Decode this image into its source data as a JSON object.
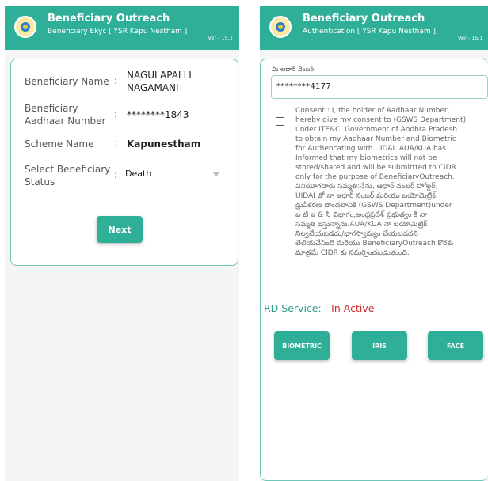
{
  "app": {
    "title": "Beneficiary Outreach",
    "version": "Ver - 15.1",
    "brand_color": "#2fae98"
  },
  "left_screen": {
    "subtitle": "Beneficiary Ekyc [ YSR Kapu Nestham ]",
    "fields": {
      "name_label": "Beneficiary Name",
      "name_value_1": "NAGULAPALLI",
      "name_value_2": "NAGAMANI",
      "aadhaar_label_1": "Beneficiary",
      "aadhaar_label_2": "Aadhaar Number",
      "aadhaar_value": "********1843",
      "scheme_label": "Scheme Name",
      "scheme_value": "Kapunestham",
      "status_label_1": "Select Beneficiary",
      "status_label_2": "Status",
      "status_value": "Death",
      "colon": ":"
    },
    "next_label": "Next"
  },
  "right_screen": {
    "subtitle": "Authentication [ YSR Kapu Nestham ]",
    "aadhaar_label": "మీ ఆధార్ నెంబర్",
    "aadhaar_value": "********4177",
    "consent_lines": [
      "Consent : I, the holder of Aadhaar Number,",
      "hereby give my consent to (GSWS Department)",
      "under ITE&C, Government of Andhra Pradesh",
      "to obtain my Aadhaar Number and Biometric",
      "for Authencating with UIDAI. AUA/KUA has",
      "Informed that my biometrics will not be",
      "stored/shared and will be submittted to CIDR",
      "only for the purpose of BeneficiaryOutreach.",
      "వినియోగదారు సమ్మతి:నేను, ఆధార్ నంబర్ హోల్డర్,",
      "UIDAI తో నా ఆధార్ నంబర్ మరియు బయోమెట్రిక్",
      "ధ్రువీకరణ పొందటానికి (GSWS Department)under",
      "ఐ టి ఇ & సి విభాగం,ఆంధ్రప్రదేశ్ ప్రభుత్వం కి నా",
      "సమ్మతి ఇస్తున్నాను.AUA/KUA నా బయోమెట్రిక్",
      "నిల్వచేయబడదు/భాగస్వామ్యం చేయబడదని",
      "తెలియచేసింది మరియు BeneficiaryOutreach కొరకు",
      "మాత్రమే CIDR కు సమర్పించబడుతుంది."
    ],
    "rd_service_label": "RD Service: -",
    "rd_service_value": "In Active",
    "buttons": {
      "biometric": "BIOMETRIC",
      "iris": "IRIS",
      "face": "FACE"
    }
  }
}
